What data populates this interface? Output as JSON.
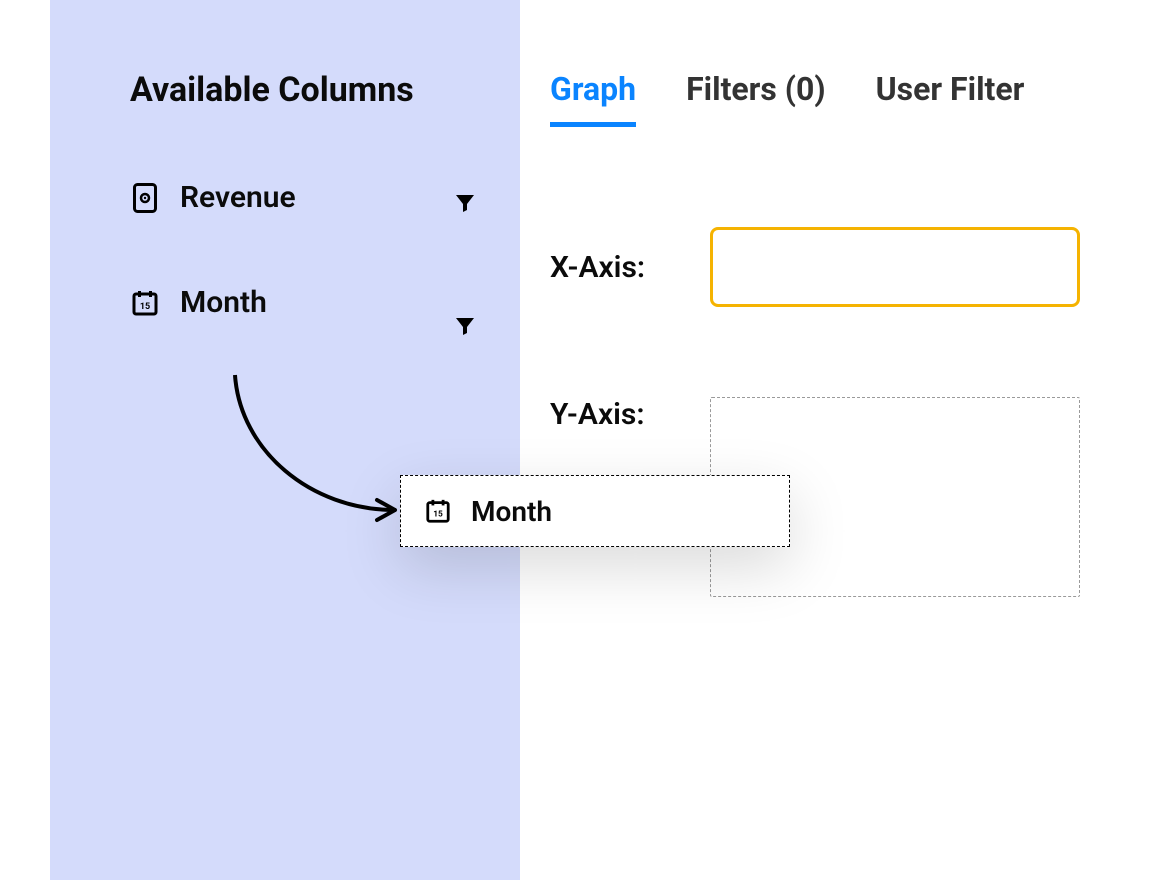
{
  "sidebar": {
    "title": "Available Columns",
    "items": [
      {
        "label": "Revenue",
        "icon": "money-icon"
      },
      {
        "label": "Month",
        "icon": "calendar-icon"
      }
    ]
  },
  "tabs": {
    "graph": "Graph",
    "filters": "Filters (0)",
    "user_filter": "User Filter",
    "active": "graph"
  },
  "axes": {
    "x_label": "X-Axis:",
    "y_label": "Y-Axis:"
  },
  "drag": {
    "ghost_label": "Month"
  }
}
